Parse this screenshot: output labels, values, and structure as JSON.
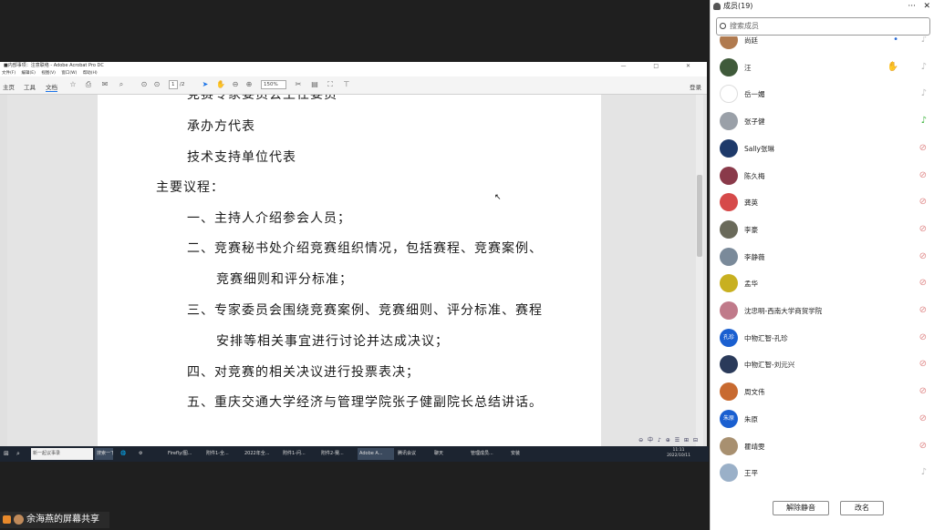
{
  "acrobat": {
    "title": "■内部事项：注意联络 - Adobe Acrobat Pro DC",
    "window_controls": "— □ ✕",
    "menu": [
      "文件(F)",
      "编辑(E)",
      "视图(V)",
      "窗口(W)",
      "帮助(H)"
    ],
    "tabs": [
      "主页",
      "工具",
      "文档"
    ],
    "page_input": "1",
    "page_total": "/2",
    "zoom": "150%",
    "login": "登录"
  },
  "document": {
    "lines": [
      "竞赛专家委员会主任委员",
      "承办方代表",
      "技术支持单位代表",
      "主要议程：",
      "一、主持人介绍参会人员；",
      "二、竞赛秘书处介绍竞赛组织情况，包括赛程、竞赛案例、",
      "竞赛细则和评分标准；",
      "三、专家委员会围绕竞赛案例、竞赛细则、评分标准、赛程",
      "安排等相关事宜进行讨论并达成决议；",
      "四、对竞赛的相关决议进行投票表决；",
      "五、重庆交通大学经济与管理学院张子健副院长总结讲话。"
    ],
    "bottom_nav": [
      "⊖",
      "中",
      "♪",
      "⊕",
      "☰",
      "⊞",
      "⊟"
    ]
  },
  "taskbar": {
    "items": [
      "⊞",
      "⌕",
      "新一起议事录",
      "搜索一下",
      "🌐",
      "⚙",
      "Firefly/图...",
      "附件1-全...",
      "2022年全...",
      "附件1-问...",
      "附件2-赛...",
      "Adobe A...",
      "腾讯会议",
      "聊天",
      "管理成员...",
      "安装"
    ],
    "time": "11:11",
    "date": "2022/10/11"
  },
  "share": {
    "label": "余海燕的屏幕共享"
  },
  "panel": {
    "title": "成员(19)",
    "more": "···",
    "close": "✕",
    "search_placeholder": "搜索成员",
    "members": [
      {
        "name": "尚廷",
        "avatar_text": "",
        "color": "#b07a4f",
        "mic": "off",
        "hand": true
      },
      {
        "name": "汪",
        "avatar_text": "",
        "color": "#3f5a3a",
        "mic": "hand",
        "hand": true
      },
      {
        "name": "岳一媚",
        "avatar_text": "",
        "color": "#ffffff",
        "mic": "off",
        "hand": false
      },
      {
        "name": "张子健",
        "avatar_text": "",
        "color": "#9aa0a8",
        "mic": "on",
        "hand": false
      },
      {
        "name": "Sally张琳",
        "avatar_text": "",
        "color": "#1e3a6a",
        "mic": "muted",
        "hand": false
      },
      {
        "name": "陈久梅",
        "avatar_text": "",
        "color": "#8a3a4a",
        "mic": "muted",
        "hand": false
      },
      {
        "name": "龚英",
        "avatar_text": "",
        "color": "#d64a4a",
        "mic": "muted",
        "hand": false
      },
      {
        "name": "李豪",
        "avatar_text": "",
        "color": "#6a6a5a",
        "mic": "muted",
        "hand": false
      },
      {
        "name": "李静薇",
        "avatar_text": "",
        "color": "#7a8a9a",
        "mic": "muted",
        "hand": false
      },
      {
        "name": "孟华",
        "avatar_text": "",
        "color": "#c8b020",
        "mic": "muted",
        "hand": false
      },
      {
        "name": "沈忠明-西南大学商贸学院",
        "avatar_text": "",
        "color": "#c07a8a",
        "mic": "muted",
        "hand": false
      },
      {
        "name": "中物汇智-孔珍",
        "avatar_text": "孔珍",
        "color": "#1a5fd0",
        "mic": "muted",
        "hand": false
      },
      {
        "name": "中物汇智-刘元兴",
        "avatar_text": "",
        "color": "#2a3a5a",
        "mic": "muted",
        "hand": false
      },
      {
        "name": "周文伟",
        "avatar_text": "",
        "color": "#c86a30",
        "mic": "muted",
        "hand": false
      },
      {
        "name": "朱原",
        "avatar_text": "朱原",
        "color": "#1a5fd0",
        "mic": "muted",
        "hand": false
      },
      {
        "name": "瞿靖雯",
        "avatar_text": "",
        "color": "#a89070",
        "mic": "muted",
        "hand": false
      },
      {
        "name": "王平",
        "avatar_text": "",
        "color": "#9ab0c8",
        "mic": "off",
        "hand": false
      }
    ],
    "unmute_all": "解除静音",
    "rename": "改名"
  }
}
